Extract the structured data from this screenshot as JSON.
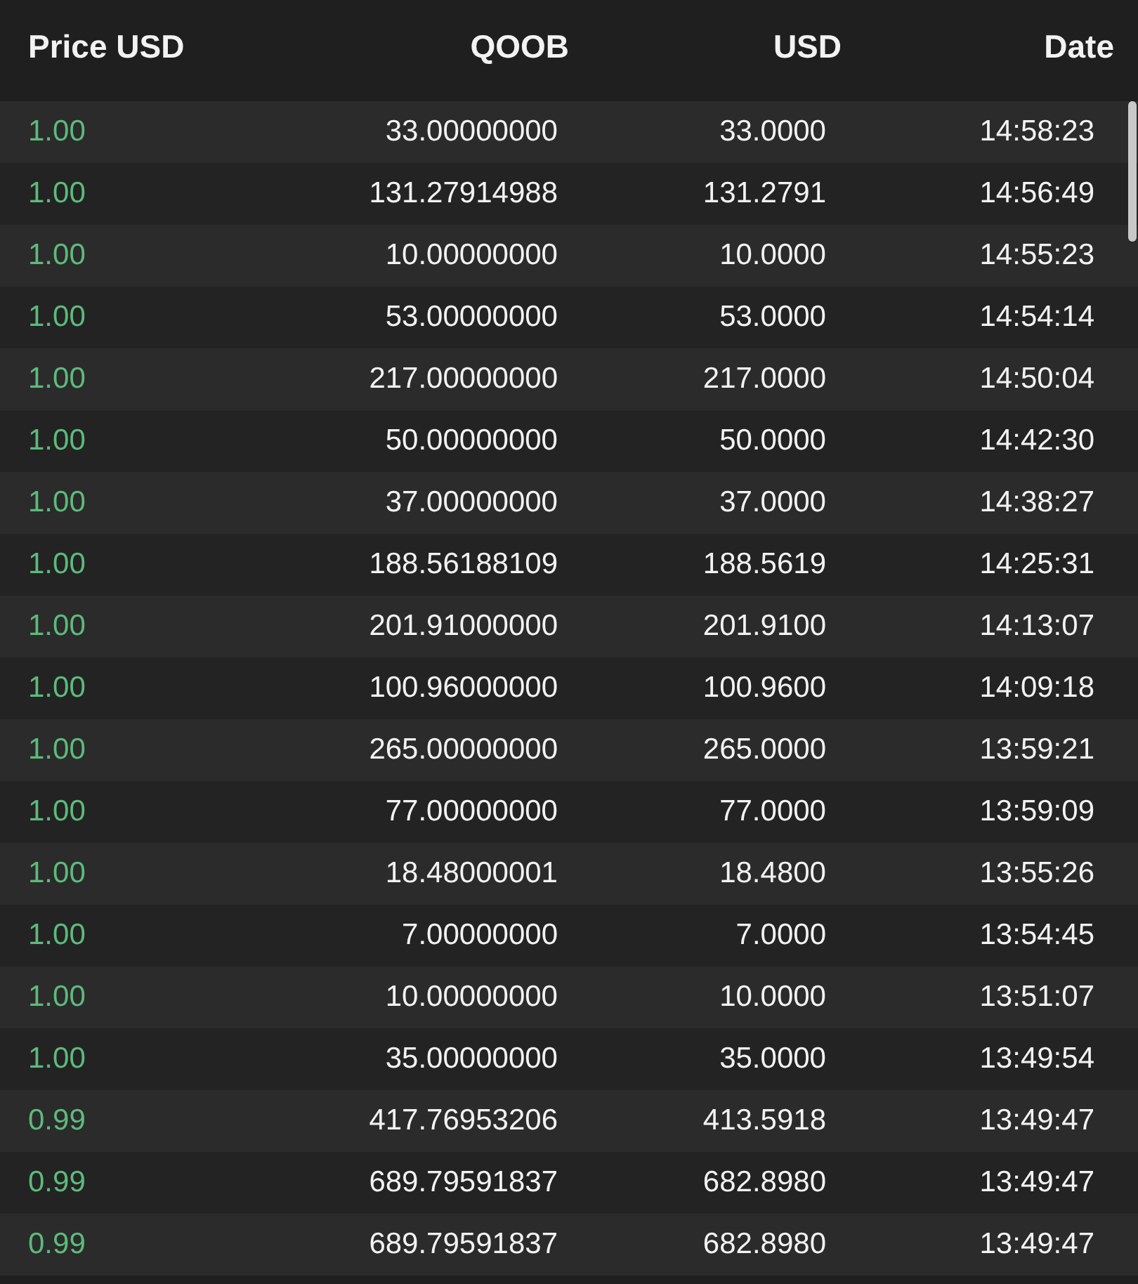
{
  "table": {
    "columns": [
      "Price USD",
      "QOOB",
      "USD",
      "Date"
    ],
    "rows": [
      {
        "color": "#5cbb7b",
        "price": "1.00",
        "qoob": "33.00000000",
        "usd": "33.0000",
        "date": "14:58:23"
      },
      {
        "color": "#5cbb7b",
        "price": "1.00",
        "qoob": "131.27914988",
        "usd": "131.2791",
        "date": "14:56:49"
      },
      {
        "color": "#5cbb7b",
        "price": "1.00",
        "qoob": "10.00000000",
        "usd": "10.0000",
        "date": "14:55:23"
      },
      {
        "color": "#5cbb7b",
        "price": "1.00",
        "qoob": "53.00000000",
        "usd": "53.0000",
        "date": "14:54:14"
      },
      {
        "color": "#5cbb7b",
        "price": "1.00",
        "qoob": "217.00000000",
        "usd": "217.0000",
        "date": "14:50:04"
      },
      {
        "color": "#5cbb7b",
        "price": "1.00",
        "qoob": "50.00000000",
        "usd": "50.0000",
        "date": "14:42:30"
      },
      {
        "color": "#5cbb7b",
        "price": "1.00",
        "qoob": "37.00000000",
        "usd": "37.0000",
        "date": "14:38:27"
      },
      {
        "color": "#5cbb7b",
        "price": "1.00",
        "qoob": "188.56188109",
        "usd": "188.5619",
        "date": "14:25:31"
      },
      {
        "color": "#5cbb7b",
        "price": "1.00",
        "qoob": "201.91000000",
        "usd": "201.9100",
        "date": "14:13:07"
      },
      {
        "color": "#5cbb7b",
        "price": "1.00",
        "qoob": "100.96000000",
        "usd": "100.9600",
        "date": "14:09:18"
      },
      {
        "color": "#5cbb7b",
        "price": "1.00",
        "qoob": "265.00000000",
        "usd": "265.0000",
        "date": "13:59:21"
      },
      {
        "color": "#5cbb7b",
        "price": "1.00",
        "qoob": "77.00000000",
        "usd": "77.0000",
        "date": "13:59:09"
      },
      {
        "color": "#5cbb7b",
        "price": "1.00",
        "qoob": "18.48000001",
        "usd": "18.4800",
        "date": "13:55:26"
      },
      {
        "color": "#5cbb7b",
        "price": "1.00",
        "qoob": "7.00000000",
        "usd": "7.0000",
        "date": "13:54:45"
      },
      {
        "color": "#5cbb7b",
        "price": "1.00",
        "qoob": "10.00000000",
        "usd": "10.0000",
        "date": "13:51:07"
      },
      {
        "color": "#5cbb7b",
        "price": "1.00",
        "qoob": "35.00000000",
        "usd": "35.0000",
        "date": "13:49:54"
      },
      {
        "color": "#5cbb7b",
        "price": "0.99",
        "qoob": "417.76953206",
        "usd": "413.5918",
        "date": "13:49:47"
      },
      {
        "color": "#5cbb7b",
        "price": "0.99",
        "qoob": "689.79591837",
        "usd": "682.8980",
        "date": "13:49:47"
      },
      {
        "color": "#5cbb7b",
        "price": "0.99",
        "qoob": "689.79591837",
        "usd": "682.8980",
        "date": "13:49:47"
      }
    ]
  }
}
